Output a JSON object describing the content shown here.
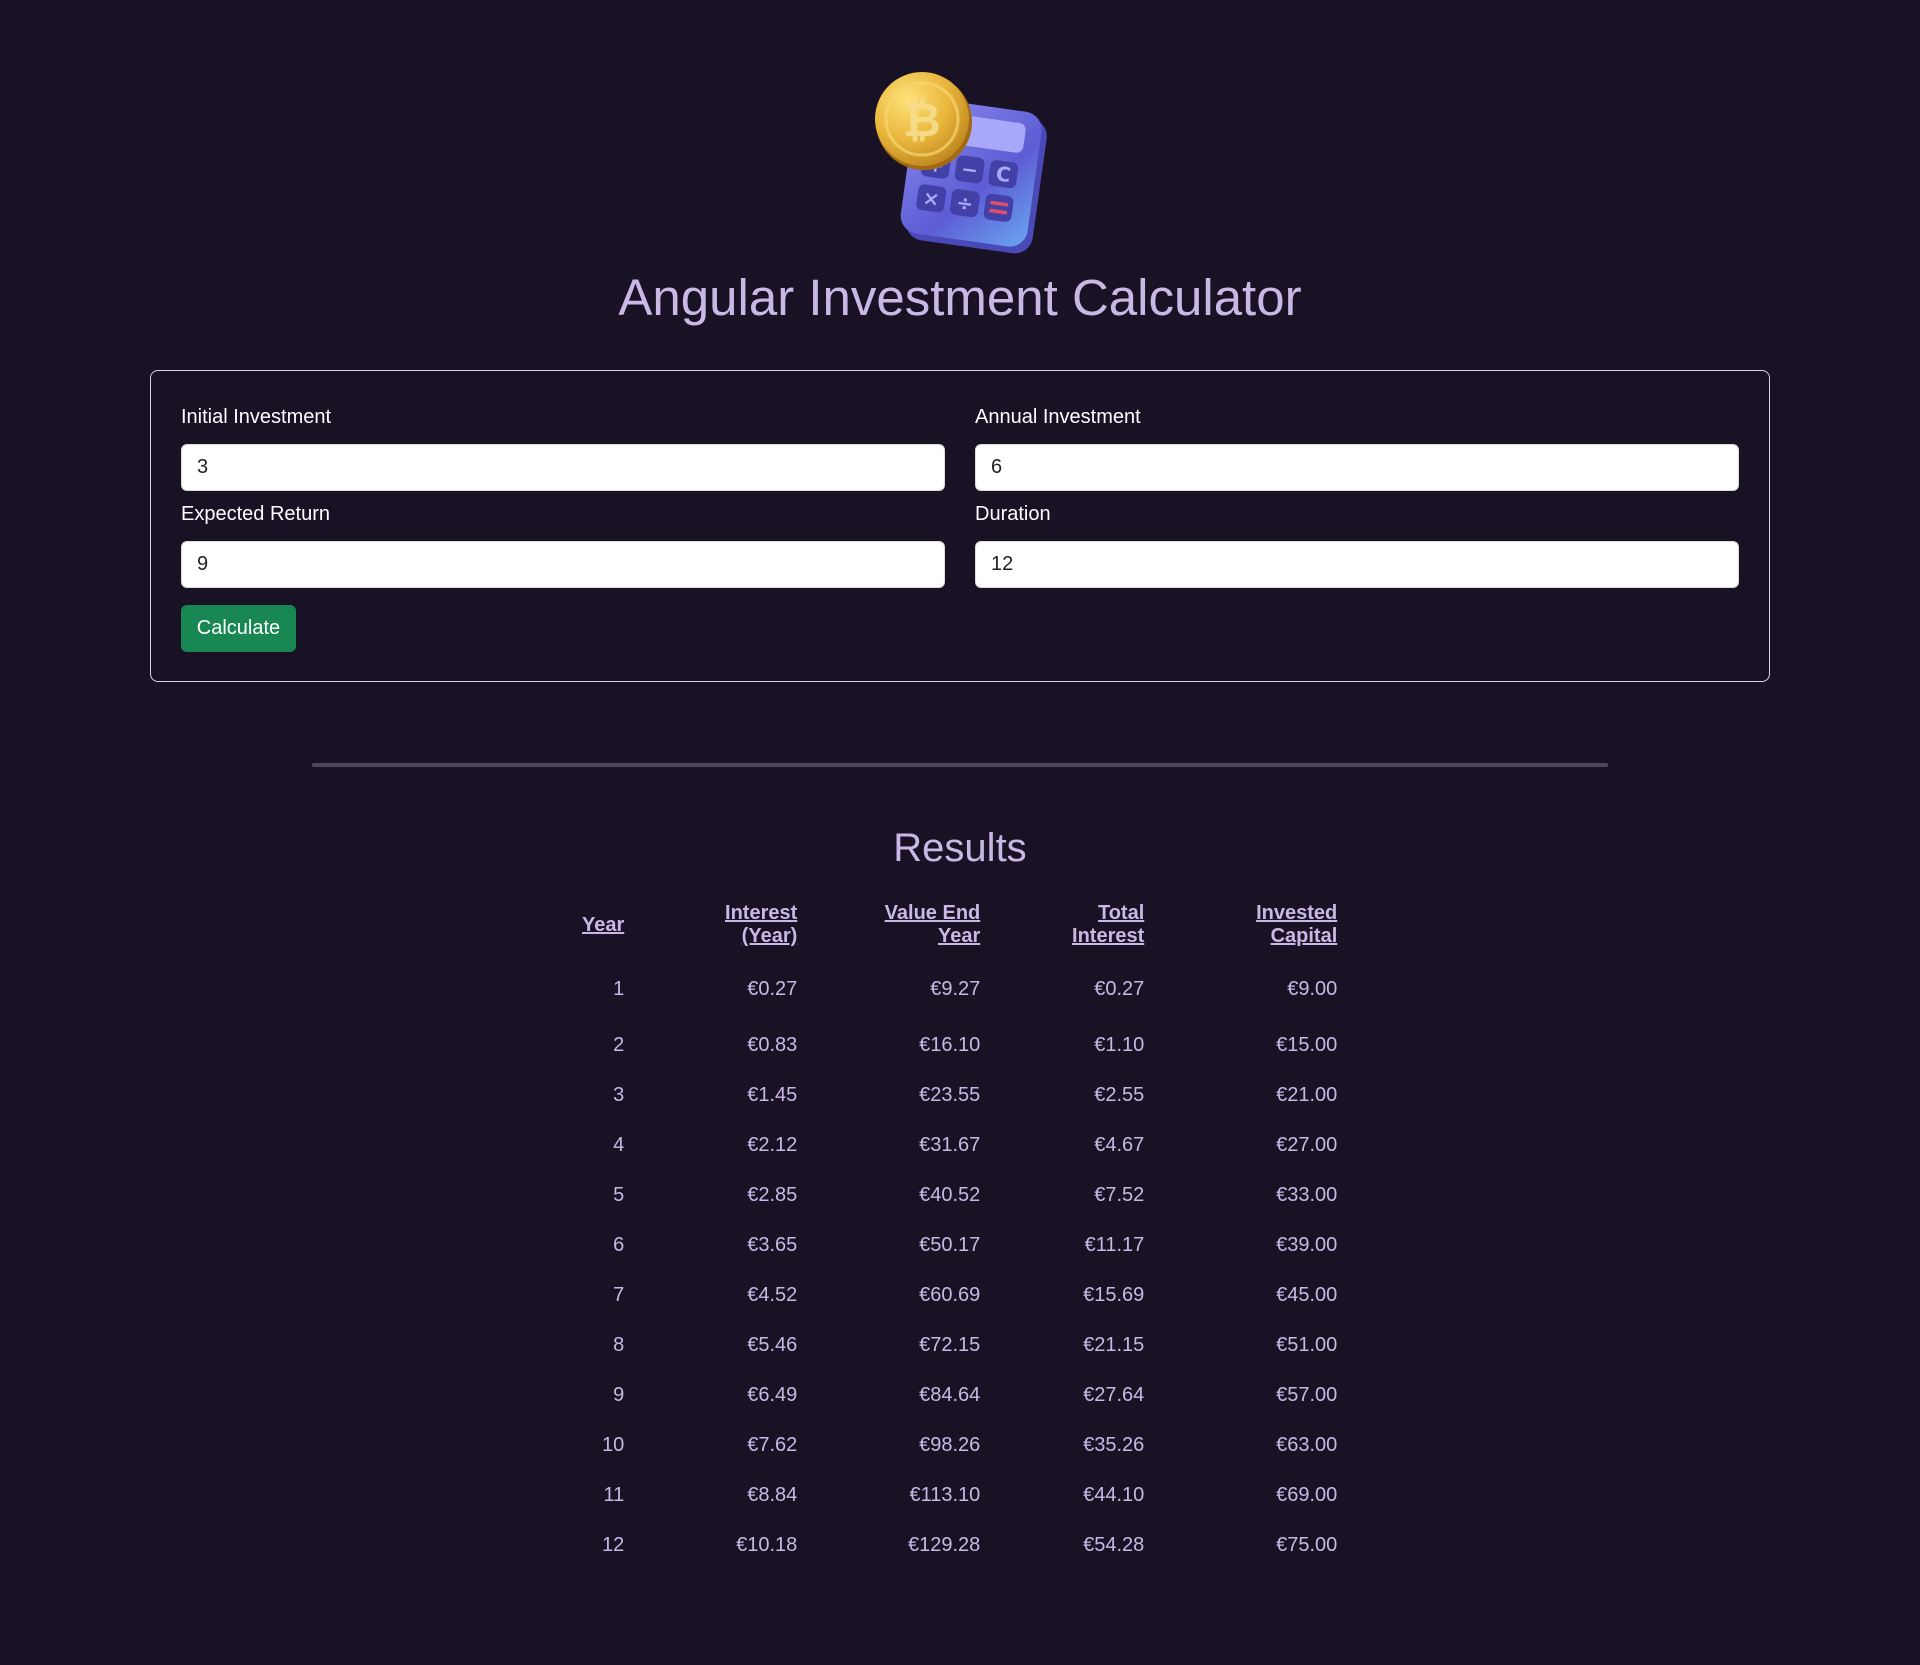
{
  "header": {
    "title": "Angular Investment Calculator"
  },
  "form": {
    "initial_investment": {
      "label": "Initial Investment",
      "value": "3"
    },
    "annual_investment": {
      "label": "Annual Investment",
      "value": "6"
    },
    "expected_return": {
      "label": "Expected Return",
      "value": "9"
    },
    "duration": {
      "label": "Duration",
      "value": "12"
    },
    "calculate_label": "Calculate",
    "button_color": "#198754"
  },
  "results": {
    "title": "Results",
    "columns": [
      "Year",
      "Interest (Year)",
      "Value End Year",
      "Total Interest",
      "Invested Capital"
    ],
    "rows": [
      [
        "1",
        "€0.27",
        "€9.27",
        "€0.27",
        "€9.00"
      ],
      [
        "2",
        "€0.83",
        "€16.10",
        "€1.10",
        "€15.00"
      ],
      [
        "3",
        "€1.45",
        "€23.55",
        "€2.55",
        "€21.00"
      ],
      [
        "4",
        "€2.12",
        "€31.67",
        "€4.67",
        "€27.00"
      ],
      [
        "5",
        "€2.85",
        "€40.52",
        "€7.52",
        "€33.00"
      ],
      [
        "6",
        "€3.65",
        "€50.17",
        "€11.17",
        "€39.00"
      ],
      [
        "7",
        "€4.52",
        "€60.69",
        "€15.69",
        "€45.00"
      ],
      [
        "8",
        "€5.46",
        "€72.15",
        "€21.15",
        "€51.00"
      ],
      [
        "9",
        "€6.49",
        "€84.64",
        "€27.64",
        "€57.00"
      ],
      [
        "10",
        "€7.62",
        "€98.26",
        "€35.26",
        "€63.00"
      ],
      [
        "11",
        "€8.84",
        "€113.10",
        "€44.10",
        "€69.00"
      ],
      [
        "12",
        "€10.18",
        "€129.28",
        "€54.28",
        "€75.00"
      ]
    ]
  },
  "theme": {
    "background": "#181224",
    "text": "#c9b8e6",
    "coin_gold": "#e8b53a",
    "calculator_purple": "#6f6ee0"
  },
  "icons": {
    "logo": "bitcoin-calculator-icon"
  }
}
